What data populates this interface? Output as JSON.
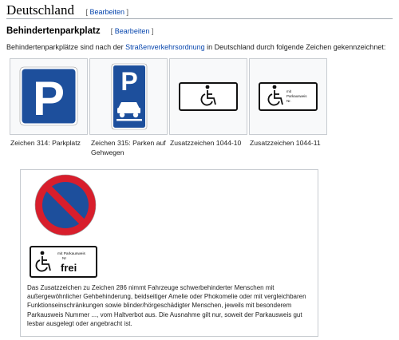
{
  "section": {
    "title": "Deutschland",
    "edit_label": "Bearbeiten"
  },
  "subsection": {
    "title": "Behindertenparkplatz",
    "edit_label": "Bearbeiten"
  },
  "intro": {
    "before": "Behindertenparkplätze sind nach der ",
    "link": "Straßenverkehrsordnung",
    "after": " in Deutschland durch folgende Zeichen gekennzeichnet:"
  },
  "gallery": [
    {
      "caption": "Zeichen 314: Parkplatz",
      "icon": "parking-sign"
    },
    {
      "caption": "Zeichen 315: Parken auf Gehwegen",
      "icon": "sidewalk-parking-sign"
    },
    {
      "caption": "Zusatzzeichen 1044-10",
      "icon": "wheelchair-plate"
    },
    {
      "caption": "Zusatzzeichen 1044-11",
      "icon": "wheelchair-parking-permit-plate"
    }
  ],
  "signs": {
    "p": "P",
    "permit_line1": "mit",
    "permit_line2": "Parkausweis",
    "permit_line3": "Nr.",
    "frei_label": "mit Parkausweis",
    "frei_nr": "Nr",
    "frei_word": "frei"
  },
  "figure": {
    "icons": [
      "no-parking-sign",
      "wheelchair-frei-plate"
    ],
    "caption": "Das Zusatzzeichen zu Zeichen 286 nimmt Fahrzeuge schwerbehinderter Menschen mit außergewöhnlicher Gehbehinderung, beidseitiger Amelie oder Phokomelie oder mit vergleichbaren Funktionseinschränkungen sowie blinder/hörgeschädigter Menschen, jeweils mit besonderem Parkausweis Nummer ..., vom Haltverbot aus. Die Ausnahme gilt nur, soweit der Parkausweis gut lesbar ausgelegt oder angebracht ist."
  },
  "colors": {
    "link": "#0645ad",
    "sign_blue": "#1d4f9c",
    "sign_red": "#d81e2c",
    "border": "#c8ccd1"
  }
}
